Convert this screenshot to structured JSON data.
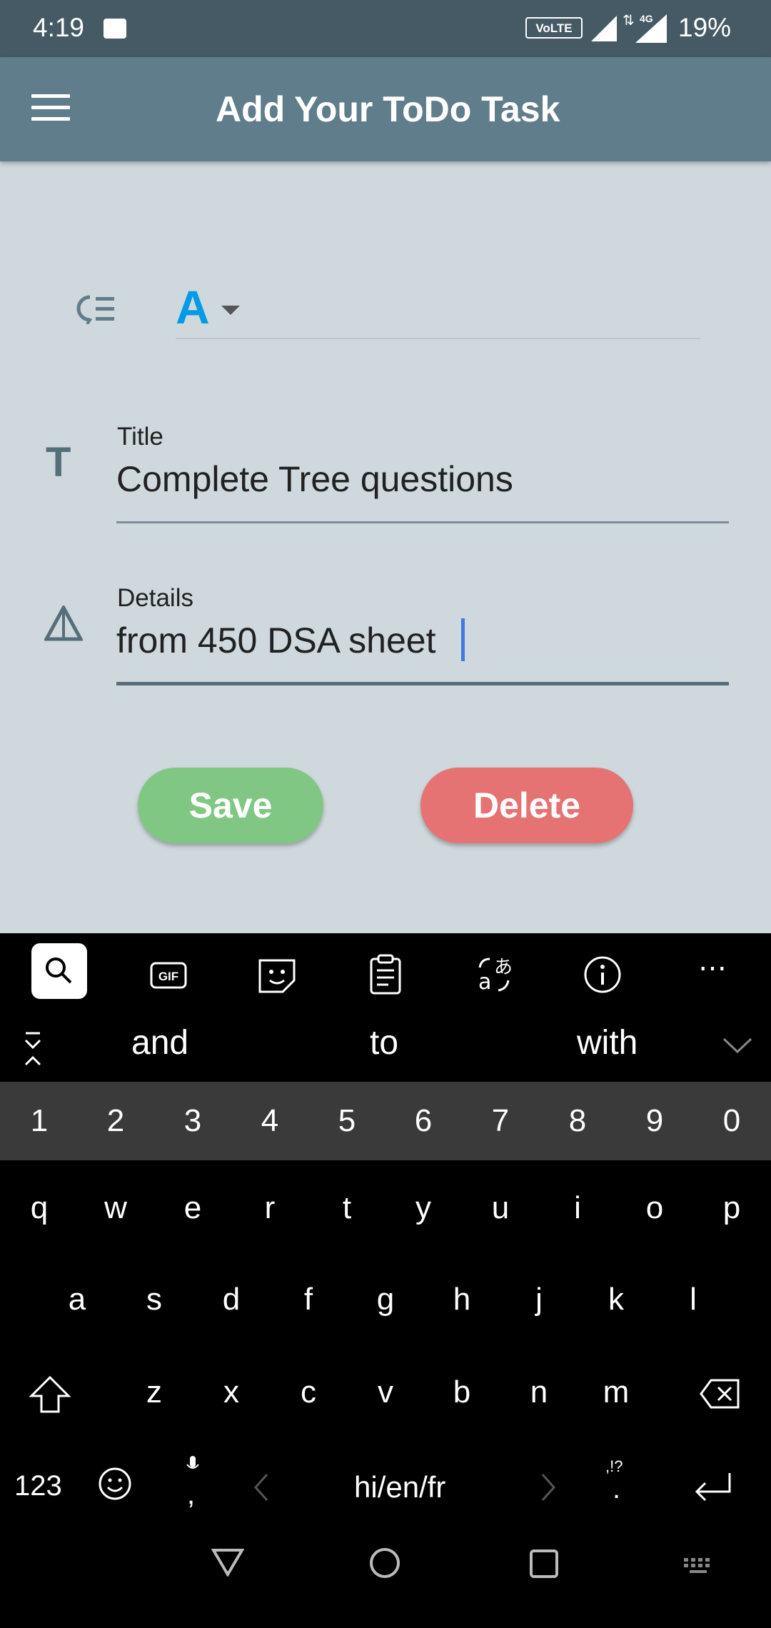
{
  "status_bar": {
    "time": "4:19",
    "volte": "VoLTE",
    "network": "4G",
    "battery": "19%"
  },
  "app_bar": {
    "title": "Add Your ToDo Task",
    "menu_icon": "hamburger-menu-icon"
  },
  "priority": {
    "icon": "priority-list-icon",
    "font_letter": "A",
    "accent_color": "#039be5"
  },
  "form": {
    "title_label": "Title",
    "title_value": "Complete Tree questions",
    "details_label": "Details",
    "details_value": "from 450 DSA sheet"
  },
  "buttons": {
    "save_label": "Save",
    "save_color": "#81c784",
    "delete_label": "Delete",
    "delete_color": "#e57373"
  },
  "keyboard": {
    "toolbar_icons": [
      "search-icon",
      "gif-icon",
      "sticker-icon",
      "clipboard-icon",
      "translate-icon",
      "info-icon",
      "more-icon"
    ],
    "suggestions": [
      "and",
      "to",
      "with"
    ],
    "number_row": [
      "1",
      "2",
      "3",
      "4",
      "5",
      "6",
      "7",
      "8",
      "9",
      "0"
    ],
    "row1": [
      "q",
      "w",
      "e",
      "r",
      "t",
      "y",
      "u",
      "i",
      "o",
      "p"
    ],
    "row2": [
      "a",
      "s",
      "d",
      "f",
      "g",
      "h",
      "j",
      "k",
      "l"
    ],
    "row3": [
      "z",
      "x",
      "c",
      "v",
      "b",
      "n",
      "m"
    ],
    "sym_label": "123",
    "space_label": "hi/en/fr",
    "comma": ",",
    "period": ".",
    "punct_hint": ",!?"
  }
}
